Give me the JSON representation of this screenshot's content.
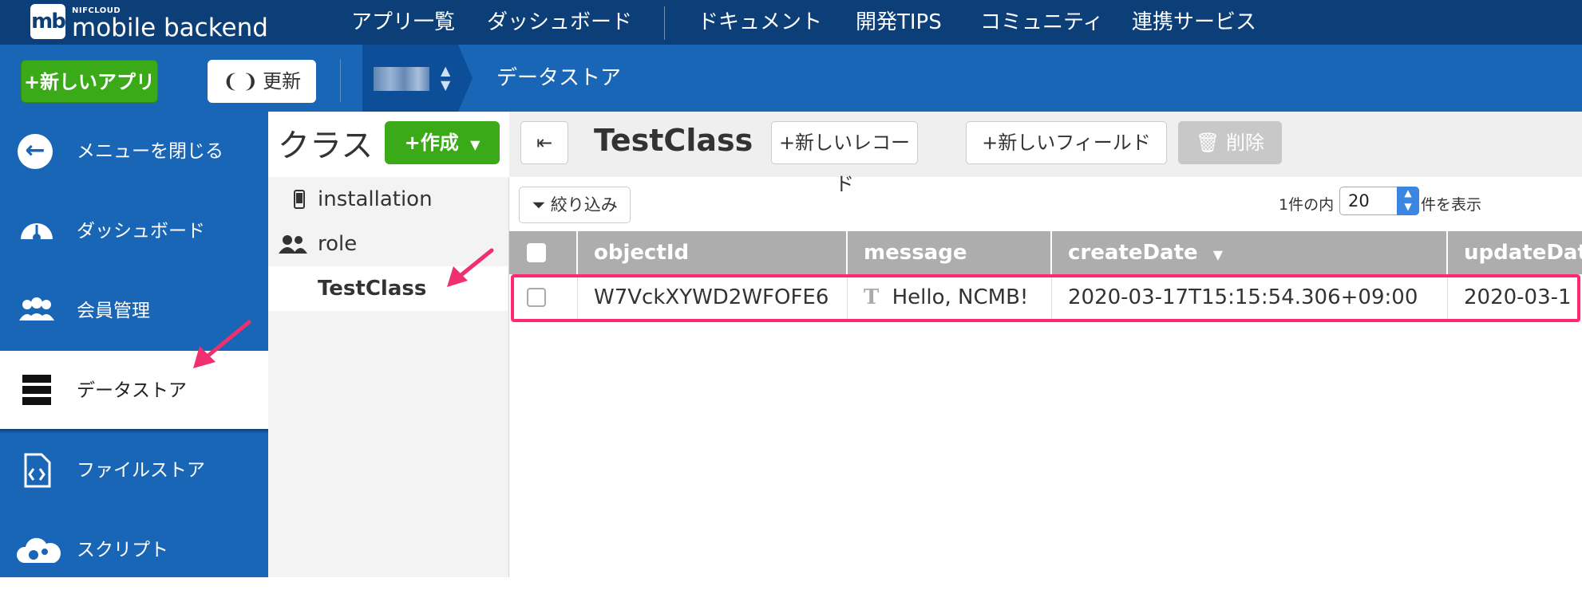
{
  "logo": {
    "small": "NIFCLOUD",
    "main": "mobile backend",
    "mark": "mb"
  },
  "topnav": {
    "items": [
      "アプリ一覧",
      "ダッシュボード",
      "ドキュメント",
      "開発TIPS",
      "コミュニティ",
      "連携サービス"
    ]
  },
  "subbar": {
    "new_app": "+新しいアプリ",
    "refresh": "更新",
    "breadcrumb": "データストア"
  },
  "sidebar": {
    "items": [
      {
        "label": "メニューを閉じる",
        "icon": "arrow-left-icon"
      },
      {
        "label": "ダッシュボード",
        "icon": "gauge-icon"
      },
      {
        "label": "会員管理",
        "icon": "users-icon"
      },
      {
        "label": "データストア",
        "icon": "database-icon"
      },
      {
        "label": "ファイルストア",
        "icon": "file-code-icon"
      },
      {
        "label": "スクリプト",
        "icon": "cloud-gears-icon"
      }
    ]
  },
  "classes": {
    "title": "クラス",
    "create": "+作成",
    "items": [
      {
        "label": "installation",
        "icon": "phone-icon"
      },
      {
        "label": "role",
        "icon": "users-icon"
      },
      {
        "label": "TestClass",
        "icon": ""
      }
    ]
  },
  "content": {
    "title": "TestClass",
    "new_record": "+新しいレコード",
    "new_field": "+新しいフィールド",
    "delete": "削除",
    "filter": "絞り込み",
    "pager_before": "1件の内",
    "pager_value": "20",
    "pager_after": "件を表示"
  },
  "table": {
    "headers": [
      "objectId",
      "message",
      "createDate",
      "updateDat"
    ],
    "rows": [
      {
        "objectId": "W7VckXYWD2WFOFE6",
        "message": "Hello, NCMB!",
        "createDate": "2020-03-17T15:15:54.306+09:00",
        "updateDate": "2020-03-1"
      }
    ]
  },
  "colors": {
    "topnav": "#0c3f77",
    "subbar": "#1a66b6",
    "green": "#3aaa18",
    "highlight": "#ff2a6e"
  }
}
